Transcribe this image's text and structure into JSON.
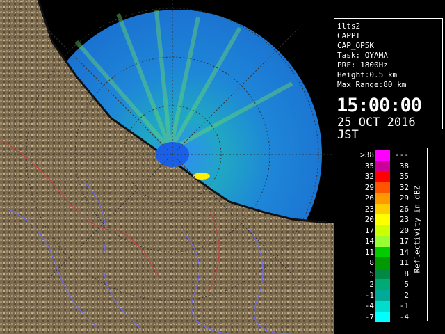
{
  "info": {
    "radar": "ilts2",
    "product": "CAPPI",
    "cap": "CAP_OP5K",
    "task": "Task: OYAMA",
    "prf": "PRF: 1800Hz",
    "height": "Height:0.5 km",
    "max_range": "Max Range:80 km",
    "time": "15:00:00",
    "date": "25 OCT 2016 JST"
  },
  "legend": {
    "axis_label": "Reflectivity in dBZ",
    "rows": [
      {
        "lo": ">38",
        "hi": "---",
        "color": "#ff00ff"
      },
      {
        "lo": "35",
        "hi": "38",
        "color": "#cc0099"
      },
      {
        "lo": "32",
        "hi": "35",
        "color": "#ff0000"
      },
      {
        "lo": "29",
        "hi": "32",
        "color": "#ff5500"
      },
      {
        "lo": "26",
        "hi": "29",
        "color": "#ff9900"
      },
      {
        "lo": "23",
        "hi": "26",
        "color": "#ffcc00"
      },
      {
        "lo": "20",
        "hi": "23",
        "color": "#ffff00"
      },
      {
        "lo": "17",
        "hi": "20",
        "color": "#ccff00"
      },
      {
        "lo": "14",
        "hi": "17",
        "color": "#99ff33"
      },
      {
        "lo": "11",
        "hi": "14",
        "color": "#00cc00"
      },
      {
        "lo": "8",
        "hi": "11",
        "color": "#009900"
      },
      {
        "lo": "5",
        "hi": "8",
        "color": "#008844"
      },
      {
        "lo": "2",
        "hi": "5",
        "color": "#00aa77"
      },
      {
        "lo": "-1",
        "hi": "2",
        "color": "#00aa99"
      },
      {
        "lo": "-4",
        "hi": "-1",
        "color": "#00ddcc"
      },
      {
        "lo": "-7",
        "hi": "-4",
        "color": "#00ffff"
      }
    ]
  },
  "colors": {
    "background": "#000000",
    "land": "#8a7a5a",
    "sea_echo": "#1e7fe0",
    "range_ring": "#444444"
  }
}
